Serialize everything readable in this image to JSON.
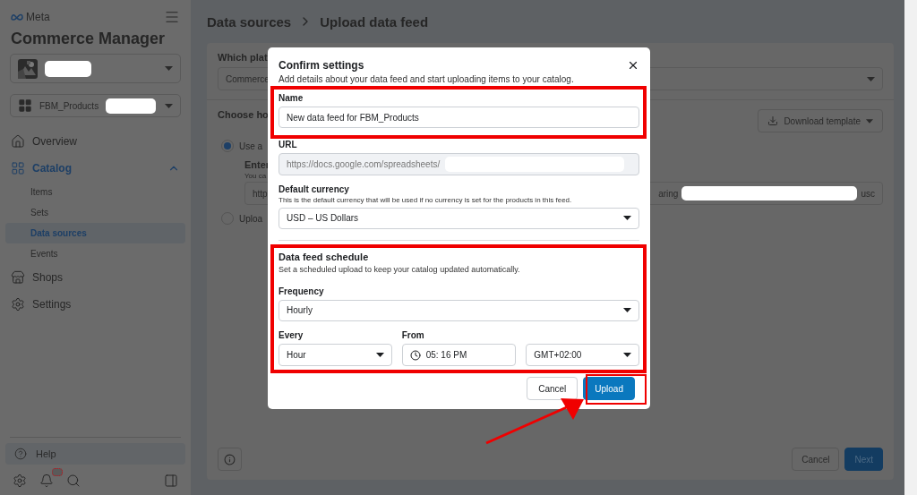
{
  "sidebar": {
    "brand": "Meta",
    "title": "Commerce Manager",
    "catalog_selector": "FBM_Products",
    "nav": [
      {
        "label": "Overview",
        "selected": false
      },
      {
        "label": "Catalog",
        "selected": true,
        "expanded": true,
        "children": [
          {
            "label": "Items",
            "selected": false
          },
          {
            "label": "Sets",
            "selected": false
          },
          {
            "label": "Data sources",
            "selected": true
          },
          {
            "label": "Events",
            "selected": false
          }
        ]
      },
      {
        "label": "Shops",
        "selected": false
      },
      {
        "label": "Settings",
        "selected": false
      }
    ],
    "help": "Help"
  },
  "breadcrumb": [
    "Data sources",
    "Upload data feed"
  ],
  "background": {
    "platform_label": "Which plat",
    "platform_value": "Commerce",
    "method_label": "Choose ho",
    "download_button": "Download template",
    "options": [
      {
        "label": "Use a",
        "selected": true
      },
      {
        "label": "Uploa",
        "selected": false
      }
    ],
    "url_title": "Enter",
    "url_hint": "You ca",
    "url_start": "http",
    "url_middle": "aring",
    "url_end": "usc",
    "buttons": [
      "Cancel",
      "Next"
    ]
  },
  "dialog": {
    "title": "Confirm settings",
    "subtitle": "Add details about your data feed and start uploading items to your catalog.",
    "name_label": "Name",
    "name_value": "New data feed for FBM_Products",
    "url_label": "URL",
    "url_value": "https://docs.google.com/spreadsheets/",
    "currency_label": "Default currency",
    "currency_hint": "This is the default currency that will be used if no currency is set for the products in this feed.",
    "currency_value": "USD – US Dollars",
    "schedule_title": "Data feed schedule",
    "schedule_hint": "Set a scheduled upload to keep your catalog updated automatically.",
    "frequency_label": "Frequency",
    "frequency_value": "Hourly",
    "every_label": "Every",
    "every_value": "Hour",
    "from_label": "From",
    "time_value": "05: 16 PM",
    "timezone_value": "GMT+02:00",
    "buttons": [
      "Cancel",
      "Upload"
    ]
  }
}
